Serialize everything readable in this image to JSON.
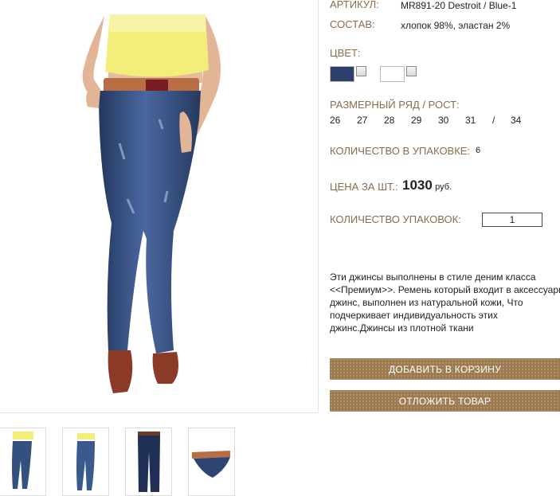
{
  "product": {
    "article_label": "АРТИКУЛ:",
    "article_value": "MR891-20 Destroit / Blue-1",
    "composition_label": "СОСТАВ:",
    "composition_value": "хлопок 98%, эластан 2%",
    "color_label": "ЦВЕТ:",
    "colors": [
      {
        "name": "denim-blue",
        "hex": "#2e3f6e"
      },
      {
        "name": "white",
        "hex": "#ffffff"
      }
    ],
    "size_label": "РАЗМЕРНЫЙ РЯД / РОСТ:",
    "sizes": [
      "26",
      "27",
      "28",
      "29",
      "30",
      "31",
      "/",
      "34"
    ],
    "pack_qty_label": "КОЛИЧЕСТВО В УПАКОВКЕ:",
    "pack_qty_value": "6",
    "price_label": "ЦЕНА ЗА ШТ.:",
    "price_value": "1030",
    "price_currency": "руб.",
    "packs_label": "КОЛИЧЕСТВО УПАКОВОК:",
    "packs_value": "1",
    "description_lines": [
      "Эти джинсы выполнены в стиле деним класса",
      "<<Премиум>>. Ремень который входит в аксессуары",
      "джинс, выполнен из натуральной кожи, Что",
      "подчеркивает индивидуальность этих",
      "джинс.Джинсы из плотной ткани"
    ]
  },
  "buttons": {
    "add_to_cart": "ДОБАВИТЬ В КОРЗИНУ",
    "postpone": "ОТЛОЖИТЬ ТОВАР"
  },
  "colors": {
    "label_brown": "#8b6b4a",
    "button_brown": "#9c7a4e",
    "denim": "#3a5585",
    "top_yellow": "#f3ee7a"
  }
}
